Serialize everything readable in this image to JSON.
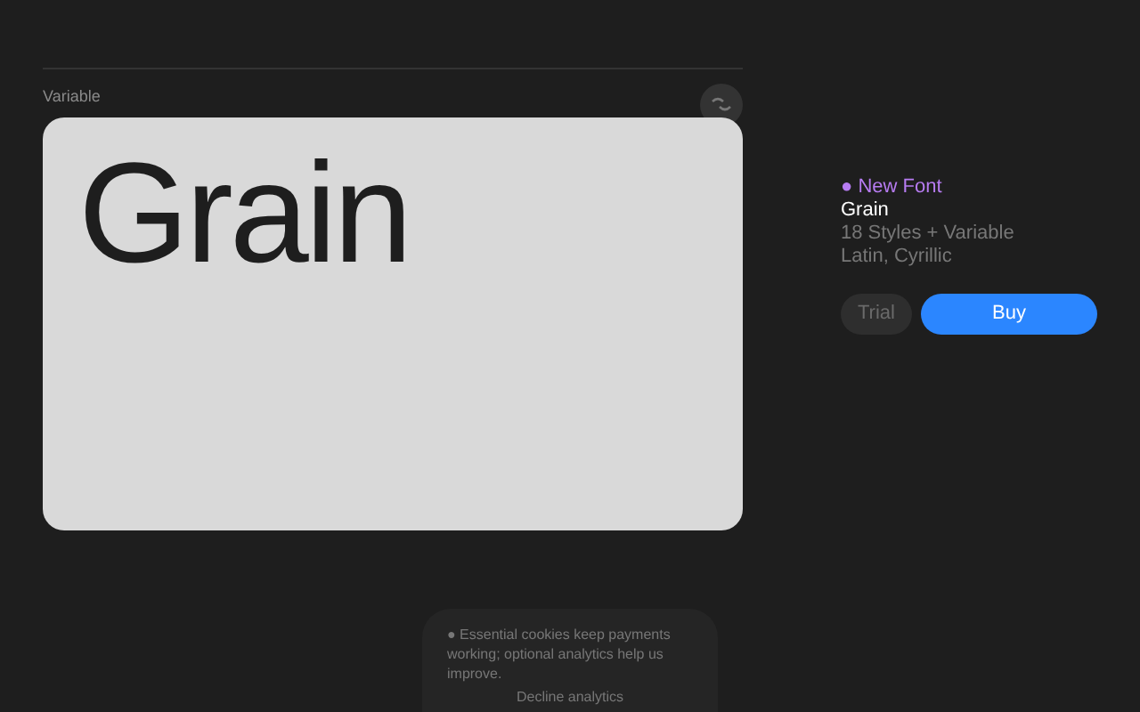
{
  "section": {
    "label": "Variable"
  },
  "specimen": {
    "text": "Grain"
  },
  "font_info": {
    "badge": "● New Font",
    "name": "Grain",
    "styles": "18 Styles + Variable",
    "scripts": "Latin, Cyrillic"
  },
  "buttons": [
    {
      "label": "Trial",
      "kind": "secondary"
    },
    {
      "label": "Buy",
      "kind": "primary"
    }
  ],
  "cookie_notice": {
    "message": "● Essential cookies keep payments working; optional analytics help us improve.",
    "action": "Decline analytics"
  }
}
